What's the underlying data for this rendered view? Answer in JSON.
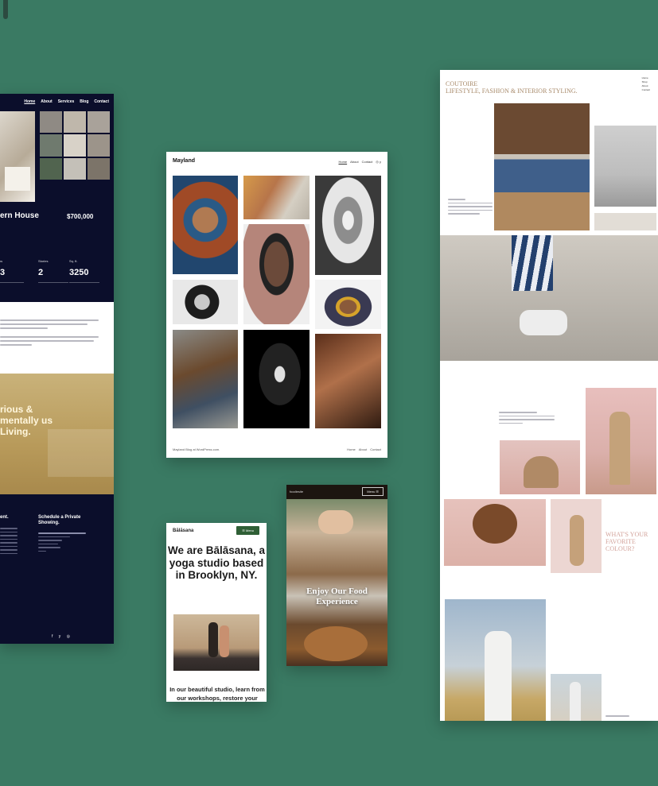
{
  "realty": {
    "nav": [
      "Home",
      "About",
      "Services",
      "Blog",
      "Contact"
    ],
    "title": "ern House",
    "price": "$700,000",
    "stats": [
      {
        "label": "rooms",
        "value": "3"
      },
      {
        "label": "Stories",
        "value": "2"
      },
      {
        "label": "Sq. ft.",
        "value": "3250"
      }
    ],
    "hero_text": "rious & mentally us Living.",
    "col1_title": "ent.",
    "col2_title": "Schedule a Private Showing.",
    "social": "f y ◎"
  },
  "mayland": {
    "logo": "Mayland",
    "nav": [
      "Home",
      "About",
      "Contact"
    ],
    "social": "◎ y",
    "footer": "Mayland Blog at WordPress.com.",
    "footer_nav": [
      "Home",
      "About",
      "Contact"
    ]
  },
  "couture": {
    "title_line1": "COUTOIRE",
    "title_line2": "LIFESTYLE, FASHION & INTERIOR STYLING.",
    "nav": [
      "Home",
      "Shop",
      "About",
      "Contact"
    ],
    "side_title": "WHAT'S YOUR FAVORITE COLOUR?"
  },
  "balasana": {
    "logo": "Bālāsana",
    "menu": "☰ Menu",
    "heading": "We are Bālāsana, a yoga studio based in Brooklyn, NY.",
    "paragraph": "In our beautiful studio, learn from our workshops, restore your body"
  },
  "foodie": {
    "logo": "foodiesite",
    "menu": "Menu ☰",
    "heading": "Enjoy Our Food Experience"
  },
  "colors": {
    "background": "#3a7a63",
    "realty_navy": "#0b0e2b",
    "balasana_green": "#2f5f36",
    "couture_accent": "#a88a6a"
  }
}
